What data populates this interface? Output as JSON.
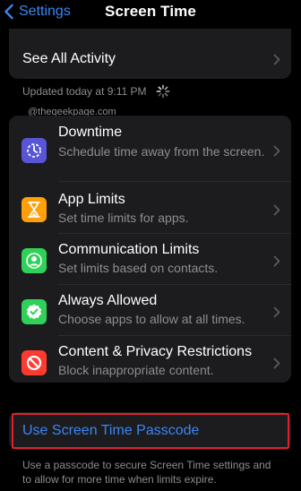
{
  "nav": {
    "back_label": "Settings",
    "title": "Screen Time"
  },
  "activity": {
    "see_all_label": "See All Activity",
    "updated_text": "Updated today at 9:11 PM"
  },
  "watermark": "@thegeekpage.com",
  "settings": [
    {
      "title": "Downtime",
      "subtitle": "Schedule time away from the screen.",
      "icon": "downtime-icon",
      "color": "#5856d6"
    },
    {
      "title": "App Limits",
      "subtitle": "Set time limits for apps.",
      "icon": "hourglass-icon",
      "color": "#ff9f0a"
    },
    {
      "title": "Communication Limits",
      "subtitle": "Set limits based on contacts.",
      "icon": "contact-icon",
      "color": "#30d158"
    },
    {
      "title": "Always Allowed",
      "subtitle": "Choose apps to allow at all times.",
      "icon": "checkmark-badge-icon",
      "color": "#30d158"
    },
    {
      "title": "Content & Privacy Restrictions",
      "subtitle": "Block inappropriate content.",
      "icon": "restriction-icon",
      "color": "#ff3b30"
    }
  ],
  "passcode": {
    "label": "Use Screen Time Passcode",
    "footer": "Use a passcode to secure Screen Time settings and to allow for more time when limits expire."
  },
  "colors": {
    "accent": "#3a86f5",
    "highlight_border": "#e0202a",
    "card_bg": "#1c1c1e"
  }
}
